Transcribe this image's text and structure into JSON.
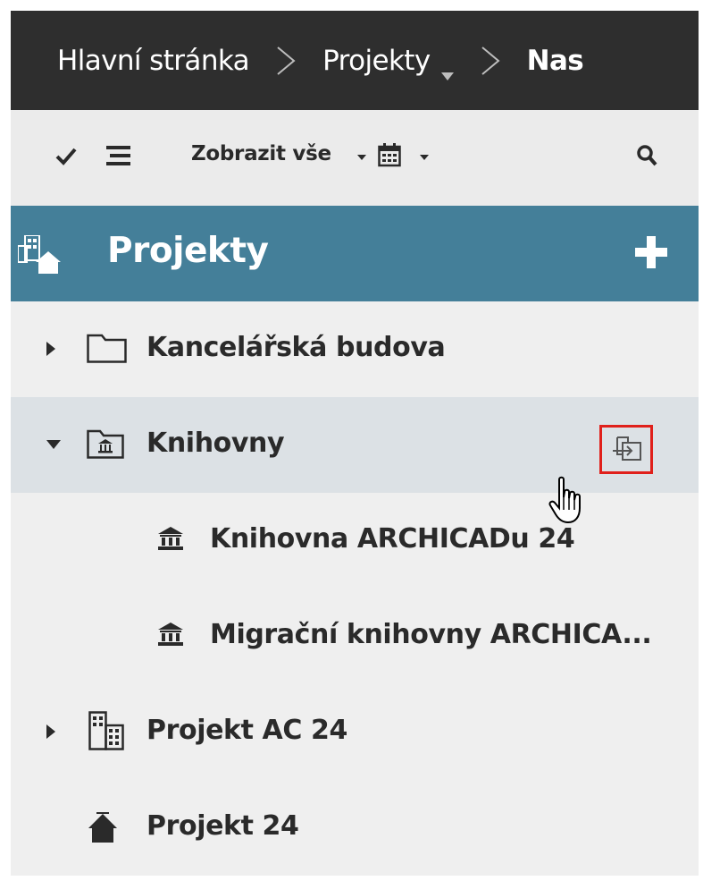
{
  "breadcrumb": {
    "items": [
      "Hlavní stránka",
      "Projekty",
      "Nas"
    ]
  },
  "toolbar": {
    "filter_label": "Zobrazit vše",
    "icons": [
      "check-icon",
      "list-icon",
      "calendar-icon",
      "search-icon"
    ]
  },
  "header": {
    "title": "Projekty",
    "icon": "projects-icon",
    "action_icon": "plus-icon"
  },
  "tree": {
    "items": [
      {
        "label": "Kancelářská budova",
        "icon": "folder-icon",
        "expander": "collapsed"
      },
      {
        "label": "Knihovny",
        "icon": "library-folder-icon",
        "expander": "expanded",
        "selected": true
      },
      {
        "label": "Knihovna ARCHICADu 24",
        "icon": "library-building-icon"
      },
      {
        "label": "Migrační knihovny ARCHICA...",
        "icon": "library-building-icon"
      },
      {
        "label": "Projekt AC 24",
        "icon": "building-icon",
        "expander": "collapsed"
      },
      {
        "label": "Projekt 24",
        "icon": "house-icon"
      }
    ]
  },
  "colors": {
    "breadcrumb_bg": "#2e2e2e",
    "toolbar_bg": "#ebebeb",
    "header_bg": "#447f99",
    "row_bg": "#efefef",
    "row_selected_bg": "#dce1e5",
    "highlight": "#e0201b"
  }
}
